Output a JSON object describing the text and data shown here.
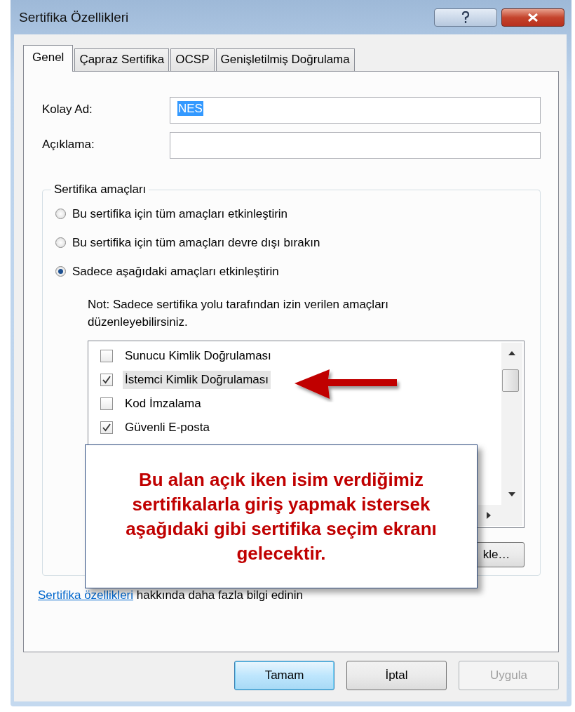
{
  "window": {
    "title": "Sertifika Özellikleri"
  },
  "tabs": [
    {
      "label": "Genel",
      "selected": true
    },
    {
      "label": "Çapraz Sertifika",
      "selected": false
    },
    {
      "label": "OCSP",
      "selected": false
    },
    {
      "label": "Genişletilmiş Doğrulama",
      "selected": false
    }
  ],
  "fields": [
    {
      "label": "Kolay Ad:",
      "value": "NES",
      "value_selected": true
    },
    {
      "label": "Açıklama:"
    }
  ],
  "purposes": {
    "title": "Sertifika amaçları",
    "options": [
      {
        "label": "Bu sertifika için tüm amaçları etkinleştirin",
        "selected": false
      },
      {
        "label": "Bu sertifika için tüm amaçları devre dışı bırakın",
        "selected": false
      },
      {
        "label": "Sadece aşağıdaki amaçları etkinleştirin",
        "selected": true
      }
    ],
    "note": "Not: Sadece sertifika yolu tarafından izin verilen amaçları düzenleyebilirsiniz.",
    "items": [
      {
        "label": "Sunucu Kimlik Doğrulaması",
        "checked": false,
        "selected": false
      },
      {
        "label": "İstemci Kimlik Doğrulaması",
        "checked": true,
        "selected": true
      },
      {
        "label": "Kod İmzalama",
        "checked": false,
        "selected": false
      },
      {
        "label": "Güvenli E-posta",
        "checked": true,
        "selected": false
      }
    ],
    "add_button": "kle…"
  },
  "link": {
    "link_text": "Sertifika özellikleri",
    "rest": " hakkında daha fazla bilgi edinin"
  },
  "buttons": [
    {
      "label": "Tamam",
      "default": true,
      "disabled": false
    },
    {
      "label": "İptal",
      "default": false,
      "disabled": false
    },
    {
      "label": "Uygula",
      "default": false,
      "disabled": true
    }
  ],
  "callout": {
    "text": "Bu alan açık iken isim verdiğimiz sertifikalarla giriş yapmak istersek aşağıdaki gibi sertifika seçim ekranı gelecektir."
  }
}
